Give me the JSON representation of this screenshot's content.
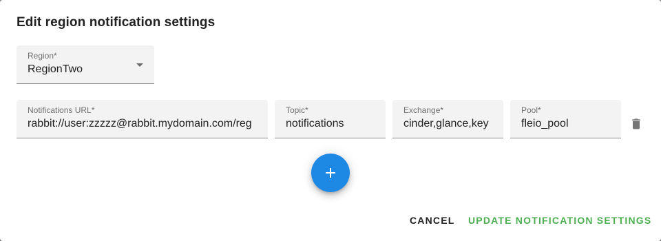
{
  "dialog": {
    "title": "Edit region notification settings"
  },
  "region": {
    "label": "Region*",
    "value": "RegionTwo"
  },
  "notification_row": {
    "url_label": "Notifications URL*",
    "url_value": "rabbit://user:zzzzz@rabbit.mydomain.com/reg",
    "topic_label": "Topic*",
    "topic_value": "notifications",
    "exchange_label": "Exchange*",
    "exchange_value": "cinder,glance,key",
    "pool_label": "Pool*",
    "pool_value": "fleio_pool"
  },
  "icons": {
    "delete": "trash-icon",
    "add": "plus-icon",
    "dropdown": "caret-down-icon"
  },
  "actions": {
    "cancel_label": "CANCEL",
    "update_label": "UPDATE NOTIFICATION SETTINGS"
  },
  "colors": {
    "accent": "#1e88e5",
    "success": "#4caf50"
  }
}
